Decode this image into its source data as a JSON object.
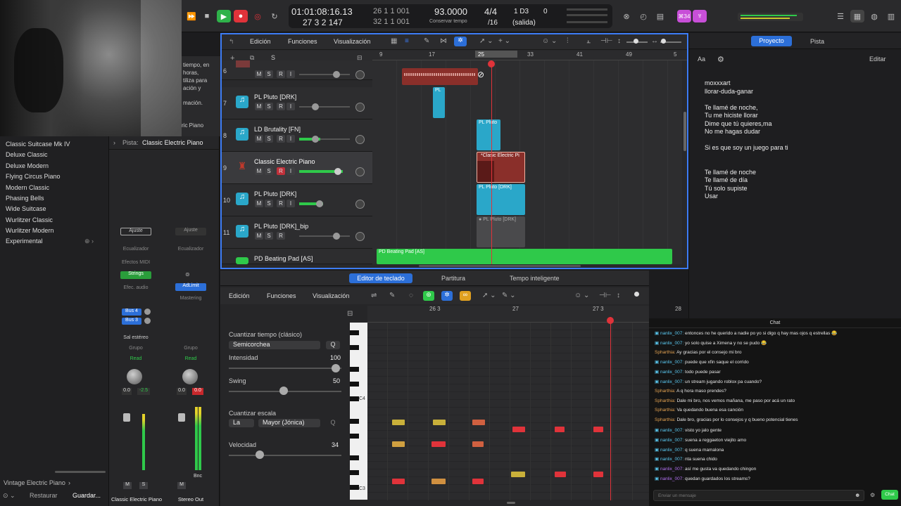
{
  "transport": {
    "position_time": "01:01:08:16.13",
    "position_bars": "27  3  2  147",
    "small_top": "26  1  1   001",
    "small_bot": "32  1  1   001",
    "tempo": "93.0000",
    "tempo_label": "Conservar tempo",
    "signature": "4/4",
    "division": "/16",
    "key": "1 D3",
    "key_val": "0",
    "output": "(salida)",
    "badge": "⌘34"
  },
  "tracks_toolbar": {
    "edit": "Edición",
    "functions": "Funciones",
    "view": "Visualización"
  },
  "ruler": [
    "9",
    "17",
    "25",
    "33",
    "41",
    "49",
    "5"
  ],
  "tracks": [
    {
      "num": "6",
      "name": ""
    },
    {
      "num": "7",
      "name": "PL Pluto [DRK]"
    },
    {
      "num": "8",
      "name": "LD Brutality [FN]"
    },
    {
      "num": "9",
      "name": "Classic Electric Piano"
    },
    {
      "num": "10",
      "name": "PL Pluto [DRK]"
    },
    {
      "num": "11",
      "name": "PL Pluto [DRK]_bip"
    },
    {
      "num": "",
      "name": "PD Beating Pad [AS]"
    }
  ],
  "regions": {
    "r7": "PL",
    "r8": "PL Pluto",
    "r9": "*Clasic Electric Pi",
    "r10": "PL Pluto [DRK]",
    "r11": "PL Pluto [DRK]",
    "r12": "PD Beating Pad [AS]"
  },
  "library": {
    "items": [
      "Classic Suitcase Mk IV",
      "Deluxe Classic",
      "Deluxe Modern",
      "Flying Circus Piano",
      "Modern Classic",
      "Phasing Bells",
      "Wide Suitcase",
      "Wurlitzer Classic",
      "Wurlitzer Modern",
      "Experimental"
    ],
    "footer_path": "Vintage Electric Piano",
    "restore": "Restaurar",
    "save": "Guardar..."
  },
  "cam_text": [
    "tiempo, en",
    "horas,",
    "tiliza para",
    "ación y",
    "mación."
  ],
  "cam_panel": "ric Piano",
  "inspector": {
    "track_label": "Pista:",
    "track_name": "Classic Electric Piano",
    "setting_a": "Ajuste",
    "setting_b": "Ajuste",
    "eq_a": "Ecualizador",
    "eq_b": "Ecualizador",
    "midi_fx": "Efectos MIDI",
    "strings": "Strings",
    "audio_fx": "Efec. audio",
    "adlimit": "AdLimit",
    "mastering": "Mastering",
    "bus4": "Bus 4",
    "bus3": "Bus 3",
    "stereo_out_label": "Sal estéreo",
    "group_a": "Grupo",
    "group_b": "Grupo",
    "read_a": "Read",
    "read_b": "Read",
    "vol_a1": "0.0",
    "vol_a2": "-2.5",
    "vol_b1": "0.0",
    "vol_b2": "0.0",
    "bnc": "Bnc",
    "ch_a_name": "Classic Electric Piano",
    "ch_b_name": "Stereo Out"
  },
  "editor": {
    "tabs": [
      "Editor de teclado",
      "Partitura",
      "Tempo inteligente"
    ],
    "edit": "Edición",
    "functions": "Funciones",
    "view": "Visualización",
    "ruler": [
      "26 3",
      "27",
      "27 3",
      "28"
    ],
    "quant_label": "Cuantizar tiempo (clásico)",
    "quant_value": "Semicorchea",
    "q": "Q",
    "intensity_label": "Intensidad",
    "intensity": "100",
    "swing_label": "Swing",
    "swing": "50",
    "scale_label": "Cuantizar escala",
    "scale_root": "La",
    "scale_mode": "Mayor (Jónica)",
    "velocity_label": "Velocidad",
    "velocity": "34",
    "c4": "C4",
    "c3": "C3"
  },
  "right_panel": {
    "tab_project": "Proyecto",
    "tab_track": "Pista",
    "edit": "Editar",
    "aa": "Aa",
    "lyrics": [
      "moxxxart",
      "llorar-duda-ganar",
      "",
      "Te llamé de noche,",
      "Tu me hiciste llorar",
      "Dime que tú quieres,ma",
      "No me hagas dudar",
      "",
      "Si es que soy un juego para ti",
      "",
      "",
      "Te llamé de noche",
      "Te llamé de día",
      "Tú solo supiste",
      "Usar"
    ]
  },
  "chat": {
    "title": "Chat",
    "input_placeholder": "Enviar un mensaje",
    "send": "Chat",
    "messages": [
      {
        "user": "nanlix_007:",
        "text": " entonces no he querido a nadie po yo si digo q hay mas ojos q estrellas 😂",
        "c": "u1"
      },
      {
        "user": "nanlix_007:",
        "text": " yo solo quise a Ximena y no se pudo 😂",
        "c": "u1"
      },
      {
        "user": "Spharthia:",
        "text": " Ay gracias por el consejo mi bro",
        "c": "u2"
      },
      {
        "user": "nanlix_007:",
        "text": " puede que xfin saque el corrido",
        "c": "u1"
      },
      {
        "user": "nanlix_007:",
        "text": " todo puede pasar",
        "c": "u1"
      },
      {
        "user": "nanlix_007:",
        "text": " un stream jugando roblox pa cuando?",
        "c": "u1"
      },
      {
        "user": "Spharthia:",
        "text": " A q hora maso prendes?",
        "c": "u2"
      },
      {
        "user": "Spharthia:",
        "text": " Dale mi bro, nos vemos mañana, me paso por acá un rato",
        "c": "u2"
      },
      {
        "user": "Spharthia:",
        "text": " Va quedando buena esa canción",
        "c": "u2"
      },
      {
        "user": "Spharthia:",
        "text": " Dale bro, gracias por lo consejos y q bueno potencial tienes",
        "c": "u2"
      },
      {
        "user": "nanlix_007:",
        "text": " visto yo jalo gente",
        "c": "u1"
      },
      {
        "user": "nanlix_007:",
        "text": " suena a reggaeton viejito amo",
        "c": "u1"
      },
      {
        "user": "nanlix_007:",
        "text": " q suena mamalona",
        "c": "u1"
      },
      {
        "user": "nanlix_007:",
        "text": " nta suena chido",
        "c": "u1"
      },
      {
        "user": "nanlix_007:",
        "text": " así me gusta va quedando chingon",
        "c": "u3"
      },
      {
        "user": "nanlix_007:",
        "text": " quedan guardados los streams?",
        "c": "u3"
      }
    ]
  }
}
